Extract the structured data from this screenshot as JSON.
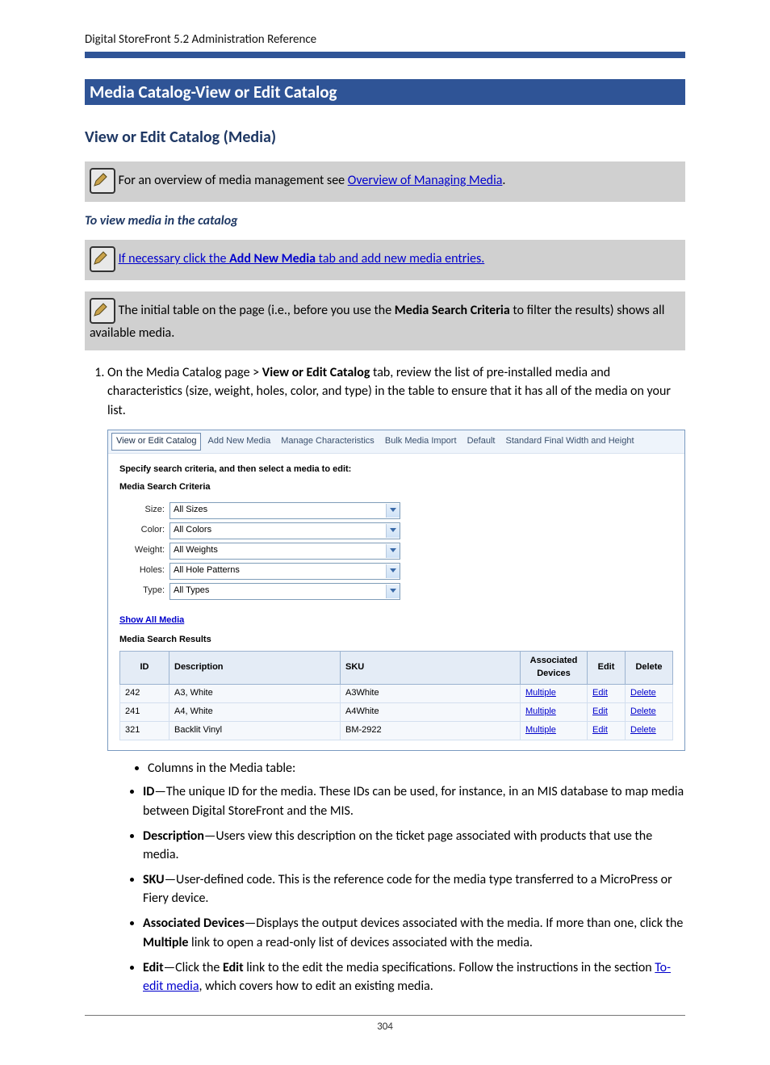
{
  "header": {
    "text": "Digital StoreFront 5.2 Administration Reference"
  },
  "title_bar": "Media Catalog-View or Edit Catalog",
  "section_h2": "View or Edit Catalog (Media)",
  "note1_pre": "For an overview of media management see ",
  "note1_link": "Overview of Managing Media",
  "note1_post": ".",
  "sub_head": "To view media in the catalog",
  "note2_pre": "If necessary click the ",
  "note2_bold": "Add New Media",
  "note2_post": " tab and add new media entries.",
  "note3_pre": "The initial table on the page (i.e., before you use the ",
  "note3_bold": "Media Search Criteria",
  "note3_post": " to filter the results) shows all available media.",
  "step1_pre": "On the Media Catalog page > ",
  "step1_bold": "View or Edit Catalog",
  "step1_post": " tab, review the list of pre-installed media and characteristics (size, weight, holes, color, and type) in the table to ensure that it has all of the media on your list.",
  "screenshot": {
    "tabs": [
      "View or Edit Catalog",
      "Add New Media",
      "Manage Characteristics",
      "Bulk Media Import",
      "Default",
      "Standard Final Width and Height"
    ],
    "instr": "Specify search criteria, and then select a media to edit:",
    "criteria_title": "Media Search Criteria",
    "criteria": [
      {
        "label": "Size:",
        "value": "All Sizes"
      },
      {
        "label": "Color:",
        "value": "All Colors"
      },
      {
        "label": "Weight:",
        "value": "All Weights"
      },
      {
        "label": "Holes:",
        "value": "All Hole Patterns"
      },
      {
        "label": "Type:",
        "value": "All Types"
      }
    ],
    "show_all": "Show All Media",
    "results_title": "Media Search Results",
    "columns": [
      "ID",
      "Description",
      "SKU",
      "Associated Devices",
      "Edit",
      "Delete"
    ],
    "rows": [
      {
        "id": "242",
        "desc": "A3, White",
        "sku": "A3White",
        "assoc": "Multiple",
        "edit": "Edit",
        "del": "Delete"
      },
      {
        "id": "241",
        "desc": "A4, White",
        "sku": "A4White",
        "assoc": "Multiple",
        "edit": "Edit",
        "del": "Delete"
      },
      {
        "id": "321",
        "desc": "Backlit Vinyl",
        "sku": "BM-2922",
        "assoc": "Multiple",
        "edit": "Edit",
        "del": "Delete"
      }
    ]
  },
  "columns_intro": "Columns in the Media table:",
  "col_defs": {
    "id_b": "ID",
    "id_t": "—The unique ID for the media. These IDs can be used, for instance, in an MIS database to map media between Digital StoreFront and the MIS.",
    "desc_b": "Description",
    "desc_t": "—Users view this description on the ticket page associated with products that use the media.",
    "sku_b": "SKU",
    "sku_t": "—User-defined code. This is the reference code for the media type transferred to a MicroPress or Fiery device.",
    "assoc_b": "Associated Devices",
    "assoc_t1": "—Displays the output devices associated with the media. If more than one, click the ",
    "assoc_bold": "Multiple",
    "assoc_t2": " link to open a read-only list of devices associated with the media.",
    "edit_b": "Edit",
    "edit_t1": "—Click the ",
    "edit_bold": "Edit",
    "edit_t2": " link to the edit the media specifications. Follow the instructions in the section ",
    "edit_link": "To-edit media",
    "edit_t3": ", which covers how to edit an existing media."
  },
  "page_number": "304"
}
